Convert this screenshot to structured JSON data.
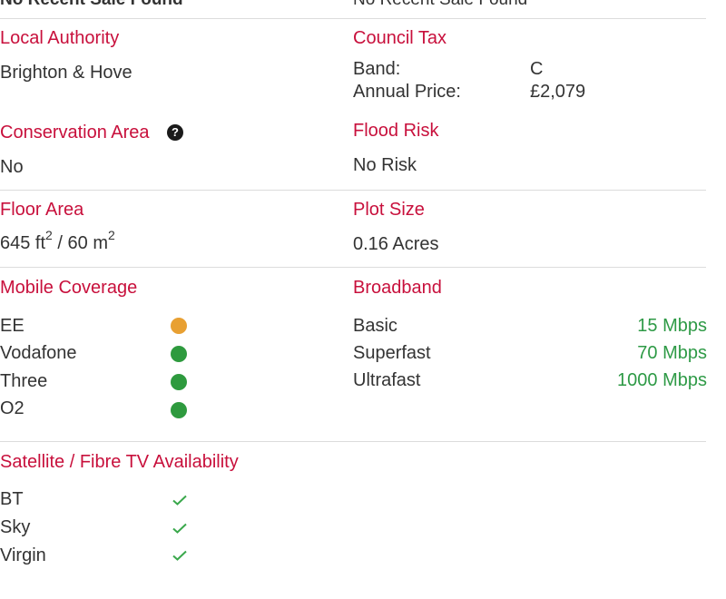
{
  "top_row": {
    "left_value": "No Recent Sale Found",
    "right_value": "No Recent Sale Found"
  },
  "local_authority": {
    "heading": "Local Authority",
    "value": "Brighton & Hove"
  },
  "council_tax": {
    "heading": "Council Tax",
    "band_label": "Band:",
    "band_value": "C",
    "price_label": "Annual Price:",
    "price_value": "£2,079"
  },
  "conservation_area": {
    "heading": "Conservation Area",
    "value": "No",
    "icon": "question-circle-icon"
  },
  "flood_risk": {
    "heading": "Flood Risk",
    "value": "No Risk"
  },
  "floor_area": {
    "heading": "Floor Area",
    "imperial": "645 ft",
    "metric": " / 60 m",
    "exponent": "2"
  },
  "plot_size": {
    "heading": "Plot Size",
    "value": "0.16 Acres"
  },
  "mobile_coverage": {
    "heading": "Mobile Coverage",
    "operators": [
      {
        "name": "EE",
        "status_color": "#e8a032"
      },
      {
        "name": "Vodafone",
        "status_color": "#2e9a3e"
      },
      {
        "name": "Three",
        "status_color": "#2e9a3e"
      },
      {
        "name": "O2",
        "status_color": "#2e9a3e"
      }
    ]
  },
  "broadband": {
    "heading": "Broadband",
    "tiers": [
      {
        "name": "Basic",
        "speed": "15 Mbps"
      },
      {
        "name": "Superfast",
        "speed": "70 Mbps"
      },
      {
        "name": "Ultrafast",
        "speed": "1000 Mbps"
      }
    ]
  },
  "tv_availability": {
    "heading": "Satellite / Fibre TV Availability",
    "providers": [
      {
        "name": "BT",
        "icon": "check-icon"
      },
      {
        "name": "Sky",
        "icon": "check-icon"
      },
      {
        "name": "Virgin",
        "icon": "check-icon"
      }
    ]
  },
  "colors": {
    "heading": "#c8103c",
    "speed": "#2e9a46",
    "check": "#3aa84c",
    "divider": "#dcdcdc"
  }
}
